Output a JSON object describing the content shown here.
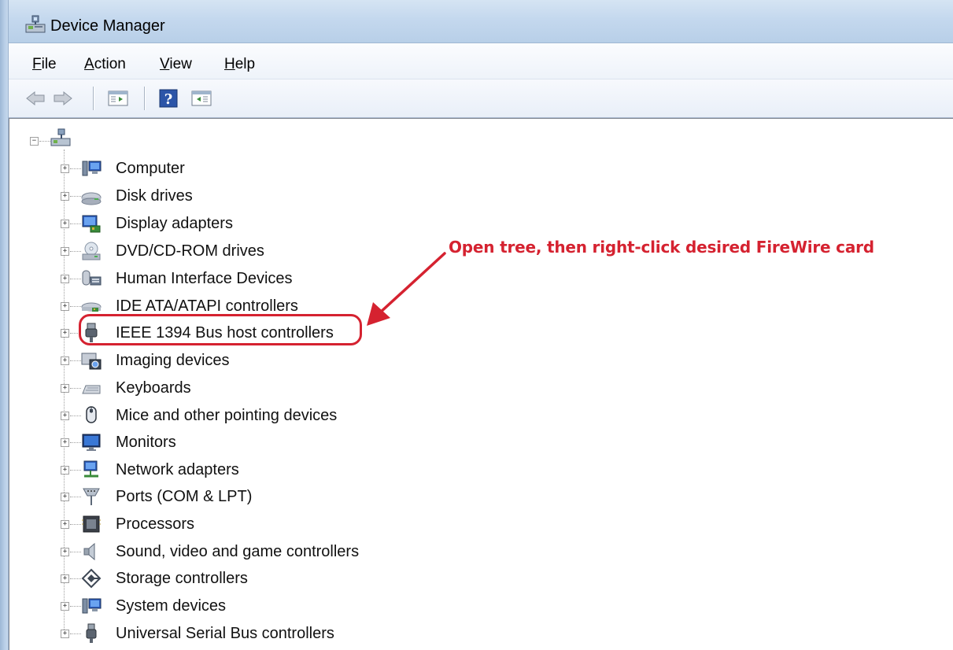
{
  "window": {
    "title": "Device Manager"
  },
  "menu": [
    {
      "label": "File",
      "accel": "F",
      "rest": "ile"
    },
    {
      "label": "Action",
      "accel": "A",
      "rest": "ction"
    },
    {
      "label": "View",
      "accel": "V",
      "rest": "iew"
    },
    {
      "label": "Help",
      "accel": "H",
      "rest": "elp"
    }
  ],
  "toolbar": {
    "back_icon": "back-arrow-icon",
    "forward_icon": "forward-arrow-icon",
    "properties_icon": "properties-icon",
    "help_icon": "help-icon",
    "action_pane_icon": "show-action-pane-icon"
  },
  "tree": {
    "root_icon": "computer-network-icon",
    "items": [
      {
        "label": "Computer",
        "icon": "computer-icon"
      },
      {
        "label": "Disk drives",
        "icon": "disk-drive-icon"
      },
      {
        "label": "Display adapters",
        "icon": "display-adapter-icon"
      },
      {
        "label": "DVD/CD-ROM drives",
        "icon": "dvd-drive-icon"
      },
      {
        "label": "Human Interface Devices",
        "icon": "hid-icon"
      },
      {
        "label": "IDE ATA/ATAPI controllers",
        "icon": "ide-controller-icon"
      },
      {
        "label": "IEEE 1394 Bus host controllers",
        "icon": "firewire-icon"
      },
      {
        "label": "Imaging devices",
        "icon": "camera-icon"
      },
      {
        "label": "Keyboards",
        "icon": "keyboard-icon"
      },
      {
        "label": "Mice and other pointing devices",
        "icon": "mouse-icon"
      },
      {
        "label": "Monitors",
        "icon": "monitor-icon"
      },
      {
        "label": "Network adapters",
        "icon": "network-adapter-icon"
      },
      {
        "label": "Ports (COM & LPT)",
        "icon": "port-icon"
      },
      {
        "label": "Processors",
        "icon": "processor-icon"
      },
      {
        "label": "Sound, video and game controllers",
        "icon": "speaker-icon"
      },
      {
        "label": "Storage controllers",
        "icon": "storage-controller-icon"
      },
      {
        "label": "System devices",
        "icon": "system-devices-icon"
      },
      {
        "label": "Universal Serial Bus controllers",
        "icon": "usb-icon"
      }
    ]
  },
  "annotation": {
    "text": "Open tree, then right-click desired FireWire card",
    "color": "#d52230"
  }
}
